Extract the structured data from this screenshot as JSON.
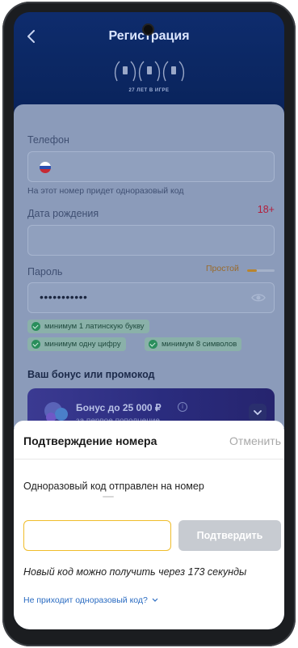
{
  "header": {
    "title": "Регистрация",
    "awards_caption": "27 ЛЕТ В ИГРЕ"
  },
  "form": {
    "phone_label": "Телефон",
    "phone_hint": "На этот номер придет одноразовый код",
    "birth_label": "Дата рождения",
    "age_badge": "18+",
    "password_label": "Пароль",
    "password_strength": "Простой",
    "password_strength_level": 0.35,
    "password_value": "•••••••••••",
    "rules": [
      {
        "label": "минимум 1 латинскую букву"
      },
      {
        "label": "минимум одну цифру"
      },
      {
        "label": "минимум 8 символов"
      }
    ],
    "bonus_section_title": "Ваш бонус или промокод",
    "bonus": {
      "title": "Бонус до 25 000 ₽",
      "subtitle": "за первое пополнение"
    }
  },
  "sheet": {
    "title": "Подтверждение номера",
    "cancel_label": "Отменить",
    "message": "Одноразовый код отправлен на номер",
    "code_value": "",
    "confirm_label": "Подтвердить",
    "timer_text": "Новый код можно получить через 173 секунды",
    "no_code_link": "Не приходит одноразовый код?"
  },
  "colors": {
    "accent_link": "#2b6cc2",
    "input_focus": "#f0bd2b",
    "age_badge": "#b31e3c",
    "button_disabled": "#c7cbd1"
  }
}
